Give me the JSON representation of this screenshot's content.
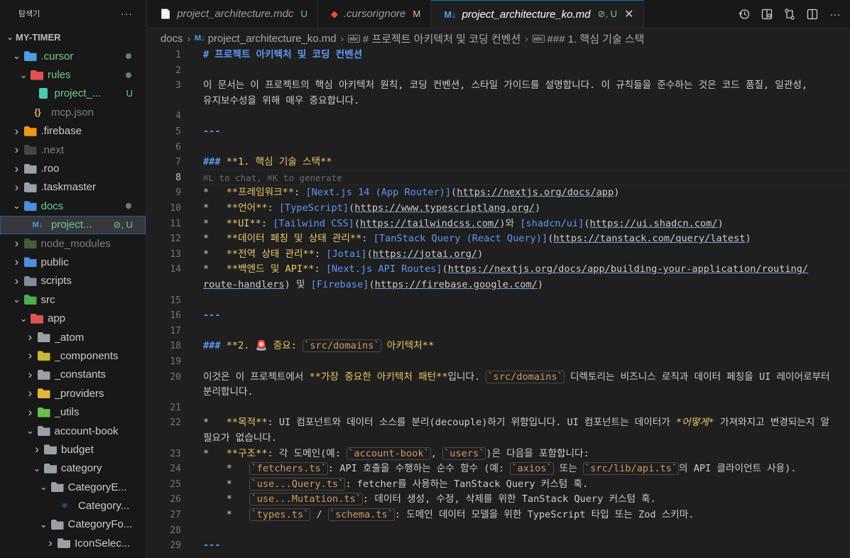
{
  "sidebar": {
    "title": "탐색기",
    "more_label": "···",
    "root_label": "MY-TIMER",
    "items": [
      {
        "label": ".cursor",
        "type": "folder",
        "open": true,
        "depth": 1,
        "status": "dot",
        "color": "#4aa0e6",
        "name_style": "git-mod"
      },
      {
        "label": "rules",
        "type": "folder",
        "open": true,
        "depth": 2,
        "status": "dot",
        "color": "#e05252",
        "name_style": "git-mod"
      },
      {
        "label": "project_...",
        "type": "file",
        "depth": 3,
        "status": "U",
        "color": "#4ec9b0",
        "name_style": "untracked"
      },
      {
        "label": "mcp.json",
        "type": "file",
        "depth": 2,
        "status": "",
        "color": "#d7ba7d",
        "name_style": "dim",
        "glyph": "{}"
      },
      {
        "label": ".firebase",
        "type": "folder",
        "open": false,
        "depth": 1,
        "status": "",
        "color": "#f29718",
        "name_style": ""
      },
      {
        "label": ".next",
        "type": "folder",
        "open": false,
        "depth": 1,
        "status": "",
        "color": "#6b6b6b",
        "name_style": "dim"
      },
      {
        "label": ".roo",
        "type": "folder",
        "open": false,
        "depth": 1,
        "status": "",
        "color": "#9aa0a6",
        "name_style": ""
      },
      {
        "label": ".taskmaster",
        "type": "folder",
        "open": false,
        "depth": 1,
        "status": "",
        "color": "#9aa0a6",
        "name_style": ""
      },
      {
        "label": "docs",
        "type": "folder",
        "open": true,
        "depth": 1,
        "status": "dot",
        "color": "#4a8fe0",
        "name_style": "git-mod"
      },
      {
        "label": "project...",
        "type": "file",
        "depth": 2,
        "status": "⊘, U",
        "color": "#4aa0e6",
        "name_style": "untracked",
        "selected": true,
        "glyph": "M↓"
      },
      {
        "label": "node_modules",
        "type": "folder",
        "open": false,
        "depth": 1,
        "status": "",
        "color": "#6a9955",
        "name_style": "dim"
      },
      {
        "label": "public",
        "type": "folder",
        "open": false,
        "depth": 1,
        "status": "",
        "color": "#4a8fe0",
        "name_style": ""
      },
      {
        "label": "scripts",
        "type": "folder",
        "open": false,
        "depth": 1,
        "status": "",
        "color": "#7f8c9a",
        "name_style": ""
      },
      {
        "label": "src",
        "type": "folder",
        "open": true,
        "depth": 1,
        "status": "",
        "color": "#4caf50",
        "name_style": ""
      },
      {
        "label": "app",
        "type": "folder",
        "open": true,
        "depth": 2,
        "status": "",
        "color": "#e05252",
        "name_style": ""
      },
      {
        "label": "_atom",
        "type": "folder",
        "open": false,
        "depth": 3,
        "status": "",
        "color": "#9aa0a6",
        "name_style": ""
      },
      {
        "label": "_components",
        "type": "folder",
        "open": false,
        "depth": 3,
        "status": "",
        "color": "#c5b83a",
        "name_style": ""
      },
      {
        "label": "_constants",
        "type": "folder",
        "open": false,
        "depth": 3,
        "status": "",
        "color": "#9aa0a6",
        "name_style": ""
      },
      {
        "label": "_providers",
        "type": "folder",
        "open": false,
        "depth": 3,
        "status": "",
        "color": "#e8b339",
        "name_style": ""
      },
      {
        "label": "_utils",
        "type": "folder",
        "open": false,
        "depth": 3,
        "status": "",
        "color": "#6abf4b",
        "name_style": ""
      },
      {
        "label": "account-book",
        "type": "folder",
        "open": true,
        "depth": 3,
        "status": "",
        "color": "#9aa0a6",
        "name_style": ""
      },
      {
        "label": "budget",
        "type": "folder",
        "open": false,
        "depth": 4,
        "status": "",
        "color": "#9aa0a6",
        "name_style": ""
      },
      {
        "label": "category",
        "type": "folder",
        "open": true,
        "depth": 4,
        "status": "",
        "color": "#9aa0a6",
        "name_style": ""
      },
      {
        "label": "CategoryE...",
        "type": "folder",
        "open": true,
        "depth": 5,
        "status": "",
        "color": "#9aa0a6",
        "name_style": ""
      },
      {
        "label": "Category...",
        "type": "file",
        "depth": 6,
        "status": "",
        "color": "#4aa0e6",
        "name_style": "",
        "glyph": "⚛"
      },
      {
        "label": "CategoryFo...",
        "type": "folder",
        "open": true,
        "depth": 5,
        "status": "",
        "color": "#9aa0a6",
        "name_style": ""
      },
      {
        "label": "IconSelec...",
        "type": "folder",
        "open": false,
        "depth": 6,
        "status": "",
        "color": "#9aa0a6",
        "name_style": ""
      }
    ]
  },
  "tabs": [
    {
      "label": "project_architecture.mdc",
      "status": "U",
      "icon": "📄",
      "icon_color": "#4ec9b0",
      "status_color": "#73c991",
      "active": false
    },
    {
      "label": ".cursorignore",
      "status": "M",
      "icon": "◆",
      "icon_color": "#e5533c",
      "status_color": "#e2c08d",
      "active": false
    },
    {
      "label": "project_architecture_ko.md",
      "status": "⊘, U",
      "icon": "M↓",
      "icon_color": "#4aa0e6",
      "status_color": "#73c991",
      "active": true,
      "close": "✕"
    }
  ],
  "breadcrumb": {
    "items": [
      "docs",
      "project_architecture_ko.md",
      "# 프로젝트 아키텍처 및 코딩 컨벤션",
      "### 1. 핵심 기술 스택"
    ]
  },
  "code": {
    "current_line": 8,
    "lines": [
      {
        "n": "1",
        "y": 0,
        "segs": [
          [
            "h",
            "# 프로젝트 아키텍처 및 코딩 컨벤션"
          ]
        ]
      },
      {
        "n": "2",
        "y": 1,
        "segs": []
      },
      {
        "n": "3",
        "y": 2,
        "segs": [
          [
            "t",
            "이 문서는 이 프로젝트의 핵심 아키텍처 원칙, 코딩 컨벤션, 스타일 가이드를 설명합니다. 이 규칙들을 준수하는 것은 코드 품질, 일관성,"
          ]
        ]
      },
      {
        "n": "",
        "y": 3,
        "segs": [
          [
            "t",
            "유지보수성을 위해 매우 중요합니다."
          ]
        ]
      },
      {
        "n": "4",
        "y": 4,
        "segs": []
      },
      {
        "n": "5",
        "y": 5,
        "segs": [
          [
            "h",
            "---"
          ]
        ]
      },
      {
        "n": "6",
        "y": 6,
        "segs": []
      },
      {
        "n": "7",
        "y": 7,
        "segs": [
          [
            "h",
            "### "
          ],
          [
            "b",
            "**1. 핵심 기술 스택**"
          ]
        ]
      },
      {
        "n": "8",
        "y": 8,
        "segs": [
          [
            "ghost",
            "⌘L to chat, ⌘K to generate"
          ]
        ]
      },
      {
        "n": "9",
        "y": 9,
        "segs": [
          [
            "bullet",
            "*   "
          ],
          [
            "b",
            "**프레임워크**"
          ],
          [
            "t",
            ": "
          ],
          [
            "lt",
            "[Next.js 14 (App Router)]"
          ],
          [
            "t",
            "("
          ],
          [
            "url",
            "https://nextjs.org/docs/app"
          ],
          [
            "t",
            ")"
          ]
        ]
      },
      {
        "n": "10",
        "y": 10,
        "segs": [
          [
            "bullet",
            "*   "
          ],
          [
            "b",
            "**언어**"
          ],
          [
            "t",
            ": "
          ],
          [
            "lt",
            "[TypeScript]"
          ],
          [
            "t",
            "("
          ],
          [
            "url",
            "https://www.typescriptlang.org/"
          ],
          [
            "t",
            ")"
          ]
        ]
      },
      {
        "n": "11",
        "y": 11,
        "segs": [
          [
            "bullet",
            "*   "
          ],
          [
            "b",
            "**UI**"
          ],
          [
            "t",
            ": "
          ],
          [
            "lt",
            "[Tailwind CSS]"
          ],
          [
            "t",
            "("
          ],
          [
            "url",
            "https://tailwindcss.com/"
          ],
          [
            "t",
            ")와 "
          ],
          [
            "lt",
            "[shadcn/ui]"
          ],
          [
            "t",
            "("
          ],
          [
            "url",
            "https://ui.shadcn.com/"
          ],
          [
            "t",
            ")"
          ]
        ]
      },
      {
        "n": "12",
        "y": 12,
        "segs": [
          [
            "bullet",
            "*   "
          ],
          [
            "b",
            "**데이터 페칭 및 상태 관리**"
          ],
          [
            "t",
            ": "
          ],
          [
            "lt",
            "[TanStack Query (React Query)]"
          ],
          [
            "t",
            "("
          ],
          [
            "url",
            "https://tanstack.com/query/latest"
          ],
          [
            "t",
            ")"
          ]
        ]
      },
      {
        "n": "13",
        "y": 13,
        "segs": [
          [
            "bullet",
            "*   "
          ],
          [
            "b",
            "**전역 상태 관리**"
          ],
          [
            "t",
            ": "
          ],
          [
            "lt",
            "[Jotai]"
          ],
          [
            "t",
            "("
          ],
          [
            "url",
            "https://jotai.org/"
          ],
          [
            "t",
            ")"
          ]
        ]
      },
      {
        "n": "14",
        "y": 14,
        "segs": [
          [
            "bullet",
            "*   "
          ],
          [
            "b",
            "**백엔드 및 API**"
          ],
          [
            "t",
            ": "
          ],
          [
            "lt",
            "[Next.js API Routes]"
          ],
          [
            "t",
            "("
          ],
          [
            "url",
            "https://nextjs.org/docs/app/building-your-application/routing/"
          ]
        ]
      },
      {
        "n": "",
        "y": 15,
        "segs": [
          [
            "url",
            "route-handlers"
          ],
          [
            "t",
            ") 및 "
          ],
          [
            "lt",
            "[Firebase]"
          ],
          [
            "t",
            "("
          ],
          [
            "url",
            "https://firebase.google.com/"
          ],
          [
            "t",
            ")"
          ]
        ]
      },
      {
        "n": "15",
        "y": 16,
        "segs": []
      },
      {
        "n": "16",
        "y": 17,
        "segs": [
          [
            "h",
            "---"
          ]
        ]
      },
      {
        "n": "17",
        "y": 18,
        "segs": []
      },
      {
        "n": "18",
        "y": 19,
        "segs": [
          [
            "h",
            "### "
          ],
          [
            "b",
            "**2. 🚨 중요: "
          ],
          [
            "ic",
            "`src/domains`"
          ],
          [
            "b",
            " 아키텍처**"
          ]
        ]
      },
      {
        "n": "19",
        "y": 20,
        "segs": []
      },
      {
        "n": "20",
        "y": 21,
        "segs": [
          [
            "t",
            "이것은 이 프로젝트에서 "
          ],
          [
            "b",
            "**가장 중요한 아키텍처 패턴**"
          ],
          [
            "t",
            "입니다. "
          ],
          [
            "ic",
            "`src/domains`"
          ],
          [
            "t",
            " 디렉토리는 비즈니스 로직과 데이터 페칭을 UI 레이어로부터"
          ]
        ]
      },
      {
        "n": "",
        "y": 22,
        "segs": [
          [
            "t",
            "분리합니다."
          ]
        ]
      },
      {
        "n": "21",
        "y": 23,
        "segs": []
      },
      {
        "n": "22",
        "y": 24,
        "segs": [
          [
            "bullet",
            "*   "
          ],
          [
            "b",
            "**목적**"
          ],
          [
            "t",
            ": UI 컴포넌트와 데이터 소스를 분리(decouple)하기 위함입니다. UI 컴포넌트는 데이터가 "
          ],
          [
            "bi",
            "*어떻게*"
          ],
          [
            "t",
            " 가져와지고 변경되는지 알"
          ]
        ]
      },
      {
        "n": "",
        "y": 25,
        "segs": [
          [
            "t",
            "필요가 없습니다."
          ]
        ]
      },
      {
        "n": "23",
        "y": 26,
        "segs": [
          [
            "bullet",
            "*   "
          ],
          [
            "b",
            "**구조**"
          ],
          [
            "t",
            ": 각 도메인(예: "
          ],
          [
            "ic",
            "`account-book`"
          ],
          [
            "t",
            ", "
          ],
          [
            "ic",
            "`users`"
          ],
          [
            "t",
            ")은 다음을 포함합니다:"
          ]
        ]
      },
      {
        "n": "24",
        "y": 27,
        "segs": [
          [
            "bullet",
            "    *   "
          ],
          [
            "ic",
            "`fetchers.ts`"
          ],
          [
            "t",
            ": API 호출을 수행하는 순수 함수 (예: "
          ],
          [
            "ic",
            "`axios`"
          ],
          [
            "t",
            " 또는 "
          ],
          [
            "ic",
            "`src/lib/api.ts`"
          ],
          [
            "t",
            "의 API 클라이언트 사용)."
          ]
        ]
      },
      {
        "n": "25",
        "y": 28,
        "segs": [
          [
            "bullet",
            "    *   "
          ],
          [
            "ic",
            "`use...Query.ts`"
          ],
          [
            "t",
            ": fetcher를 사용하는 TanStack Query 커스텀 훅."
          ]
        ]
      },
      {
        "n": "26",
        "y": 29,
        "segs": [
          [
            "bullet",
            "    *   "
          ],
          [
            "ic",
            "`use...Mutation.ts`"
          ],
          [
            "t",
            ": 데이터 생성, 수정, 삭제를 위한 TanStack Query 커스텀 훅."
          ]
        ]
      },
      {
        "n": "27",
        "y": 30,
        "segs": [
          [
            "bullet",
            "    *   "
          ],
          [
            "ic",
            "`types.ts`"
          ],
          [
            "t",
            " / "
          ],
          [
            "ic",
            "`schema.ts`"
          ],
          [
            "t",
            ": 도메인 데이터 모델을 위한 TypeScript 타입 또는 Zod 스키마."
          ]
        ]
      },
      {
        "n": "28",
        "y": 31,
        "segs": []
      },
      {
        "n": "29",
        "y": 32,
        "segs": [
          [
            "h",
            "---"
          ]
        ]
      }
    ]
  }
}
